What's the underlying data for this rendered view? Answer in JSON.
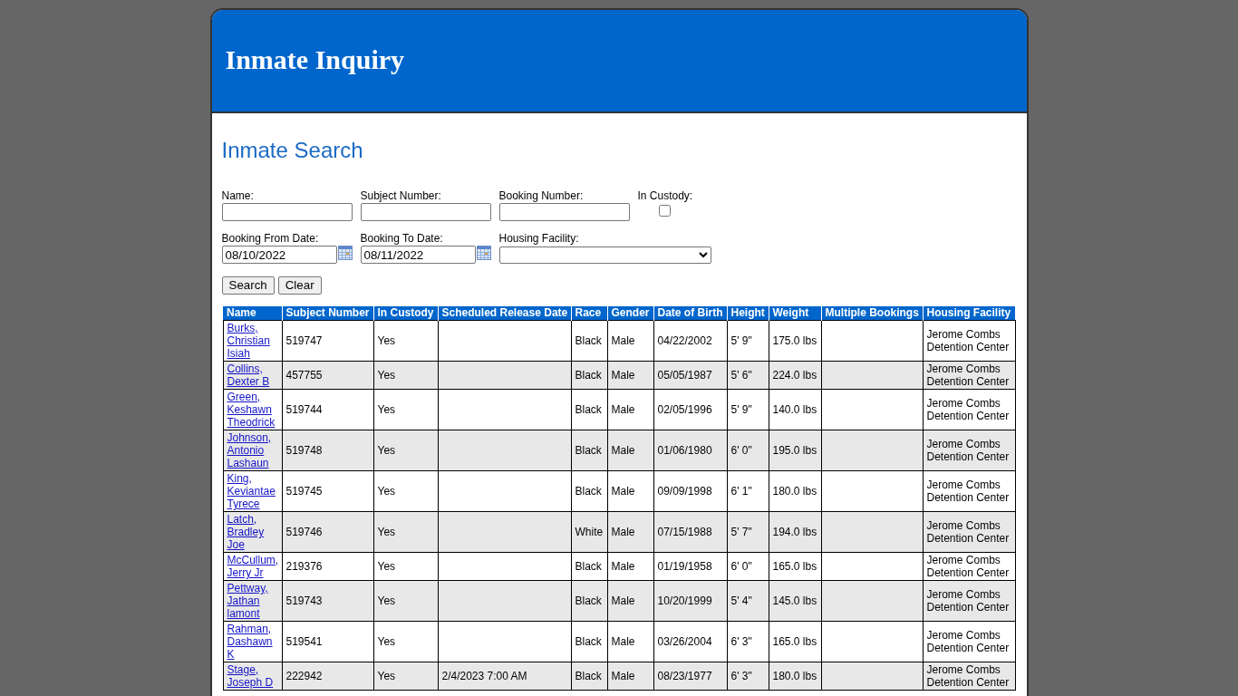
{
  "header": {
    "title": "Inmate Inquiry"
  },
  "search_form": {
    "heading": "Inmate Search",
    "fields": [
      {
        "kind": "text",
        "label": "Name:"
      },
      {
        "kind": "text",
        "label": "Subject Number:"
      },
      {
        "kind": "text",
        "label": "Booking Number:"
      },
      {
        "kind": "checkbox",
        "label": "In Custody:",
        "checked": false
      },
      {
        "kind": "date",
        "label": "Booking From Date:",
        "value": "08/10/2022"
      },
      {
        "kind": "date",
        "label": "Booking To Date:",
        "value": "08/11/2022"
      },
      {
        "kind": "select",
        "label": "Housing Facility:"
      }
    ],
    "buttons": [
      "Search",
      "Clear"
    ]
  },
  "results_table": {
    "columns": [
      "Name",
      "Subject Number",
      "In Custody",
      "Scheduled Release Date",
      "Race",
      "Gender",
      "Date of Birth",
      "Height",
      "Weight",
      "Multiple Bookings",
      "Housing Facility"
    ],
    "rows": [
      {
        "name": "Burks, Christian Isiah",
        "subject_number": "519747",
        "in_custody": "Yes",
        "race": "Black",
        "gender": "Male",
        "date_of_birth": "04/22/2002",
        "height": "5' 9\"",
        "weight": "175.0 lbs",
        "housing_facility": "Jerome Combs Detention Center"
      },
      {
        "name": "Collins, Dexter B",
        "subject_number": "457755",
        "in_custody": "Yes",
        "race": "Black",
        "gender": "Male",
        "date_of_birth": "05/05/1987",
        "height": "5' 6\"",
        "weight": "224.0 lbs",
        "housing_facility": "Jerome Combs Detention Center"
      },
      {
        "name": "Green, Keshawn Theodrick",
        "subject_number": "519744",
        "in_custody": "Yes",
        "race": "Black",
        "gender": "Male",
        "date_of_birth": "02/05/1996",
        "height": "5' 9\"",
        "weight": "140.0 lbs",
        "housing_facility": "Jerome Combs Detention Center"
      },
      {
        "name": "Johnson, Antonio Lashaun",
        "subject_number": "519748",
        "in_custody": "Yes",
        "race": "Black",
        "gender": "Male",
        "date_of_birth": "01/06/1980",
        "height": "6' 0\"",
        "weight": "195.0 lbs",
        "housing_facility": "Jerome Combs Detention Center"
      },
      {
        "name": "King, Keviantae Tyrece",
        "subject_number": "519745",
        "in_custody": "Yes",
        "race": "Black",
        "gender": "Male",
        "date_of_birth": "09/09/1998",
        "height": "6' 1\"",
        "weight": "180.0 lbs",
        "housing_facility": "Jerome Combs Detention Center"
      },
      {
        "name": "Latch, Bradley Joe",
        "subject_number": "519746",
        "in_custody": "Yes",
        "race": "White",
        "gender": "Male",
        "date_of_birth": "07/15/1988",
        "height": "5' 7\"",
        "weight": "194.0 lbs",
        "housing_facility": "Jerome Combs Detention Center"
      },
      {
        "name": "McCullum, Jerry Jr",
        "subject_number": "219376",
        "in_custody": "Yes",
        "race": "Black",
        "gender": "Male",
        "date_of_birth": "01/19/1958",
        "height": "6' 0\"",
        "weight": "165.0 lbs",
        "housing_facility": "Jerome Combs Detention Center"
      },
      {
        "name": "Pettway, Jathan lamont",
        "subject_number": "519743",
        "in_custody": "Yes",
        "race": "Black",
        "gender": "Male",
        "date_of_birth": "10/20/1999",
        "height": "5' 4\"",
        "weight": "145.0 lbs",
        "housing_facility": "Jerome Combs Detention Center"
      },
      {
        "name": "Rahman, Dashawn K",
        "subject_number": "519541",
        "in_custody": "Yes",
        "race": "Black",
        "gender": "Male",
        "date_of_birth": "03/26/2004",
        "height": "6' 3\"",
        "weight": "165.0 lbs",
        "housing_facility": "Jerome Combs Detention Center"
      },
      {
        "name": "Stage, Joseph D",
        "subject_number": "222942",
        "in_custody": "Yes",
        "scheduled_release_date": "2/4/2023 7:00 AM",
        "race": "Black",
        "gender": "Male",
        "date_of_birth": "08/23/1977",
        "height": "6' 3\"",
        "weight": "180.0 lbs",
        "housing_facility": "Jerome Combs Detention Center"
      }
    ]
  }
}
